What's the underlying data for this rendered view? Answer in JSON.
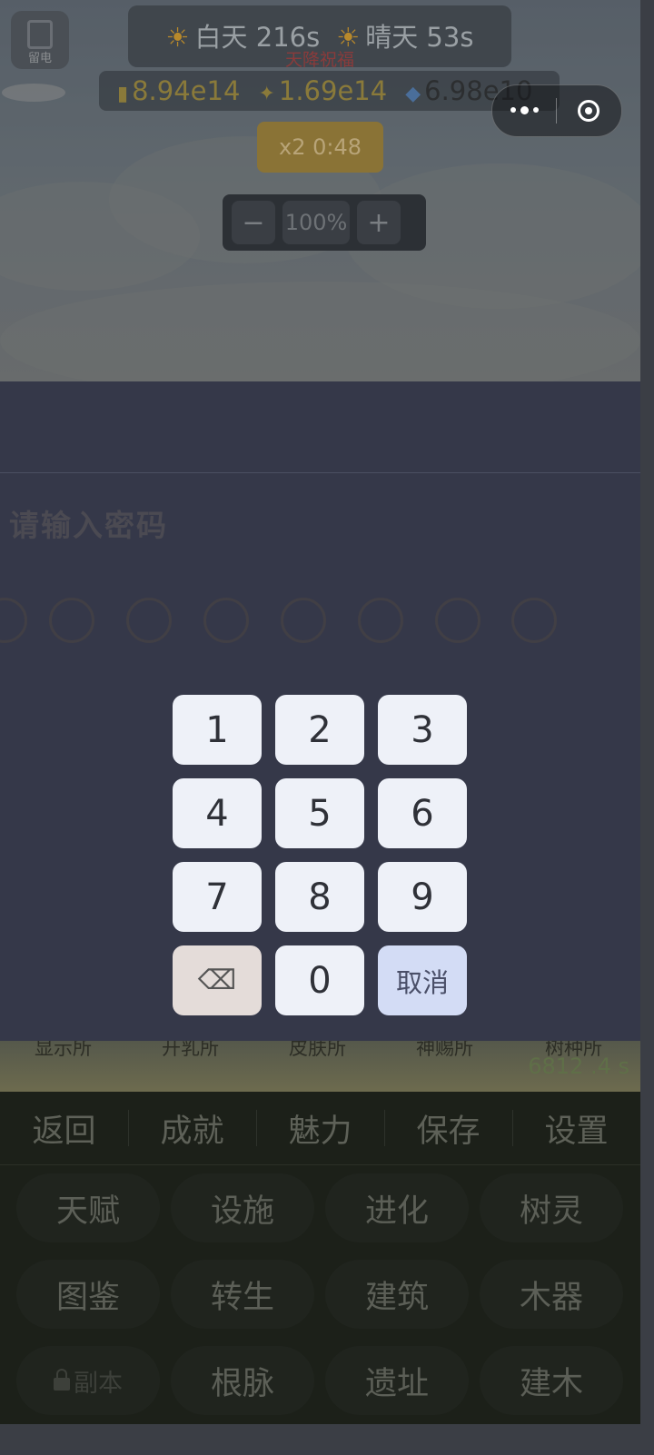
{
  "hud": {
    "menu_label": "留电",
    "weather": {
      "day_label": "白天 216s",
      "sky_label": "晴天 53s",
      "effect_label": "天降祝福"
    },
    "resources": {
      "wood": "8.94e14",
      "spark": "1.69e14",
      "gem": "6.98e10"
    },
    "boost_label": "x2 0:48",
    "zoom": {
      "minus": "−",
      "value": "100%",
      "plus": "+"
    }
  },
  "dialog": {
    "title": "请输入密码",
    "pin_length": 8,
    "keys": [
      "1",
      "2",
      "3",
      "4",
      "5",
      "6",
      "7",
      "8",
      "9",
      "",
      "0",
      "取消"
    ],
    "delete_icon": "backspace-icon",
    "cancel_label": "取消"
  },
  "strip": {
    "labels": [
      "显示所",
      "开乳所",
      "皮肤所",
      "神赐所",
      "树种所"
    ],
    "timer": "6812 .4 s"
  },
  "nav": {
    "tabs": [
      "返回",
      "成就",
      "魅力",
      "保存",
      "设置"
    ],
    "grid": [
      [
        "天赋",
        "设施",
        "进化",
        "树灵"
      ],
      [
        "图鉴",
        "转生",
        "建筑",
        "木器"
      ],
      [
        "副本",
        "根脉",
        "遗址",
        "建木"
      ]
    ]
  },
  "colors": {
    "modal_bg": "#353849",
    "key_bg": "#eef1f8",
    "cancel_bg": "#d3dcf5",
    "nav_bg": "#1c2019"
  }
}
